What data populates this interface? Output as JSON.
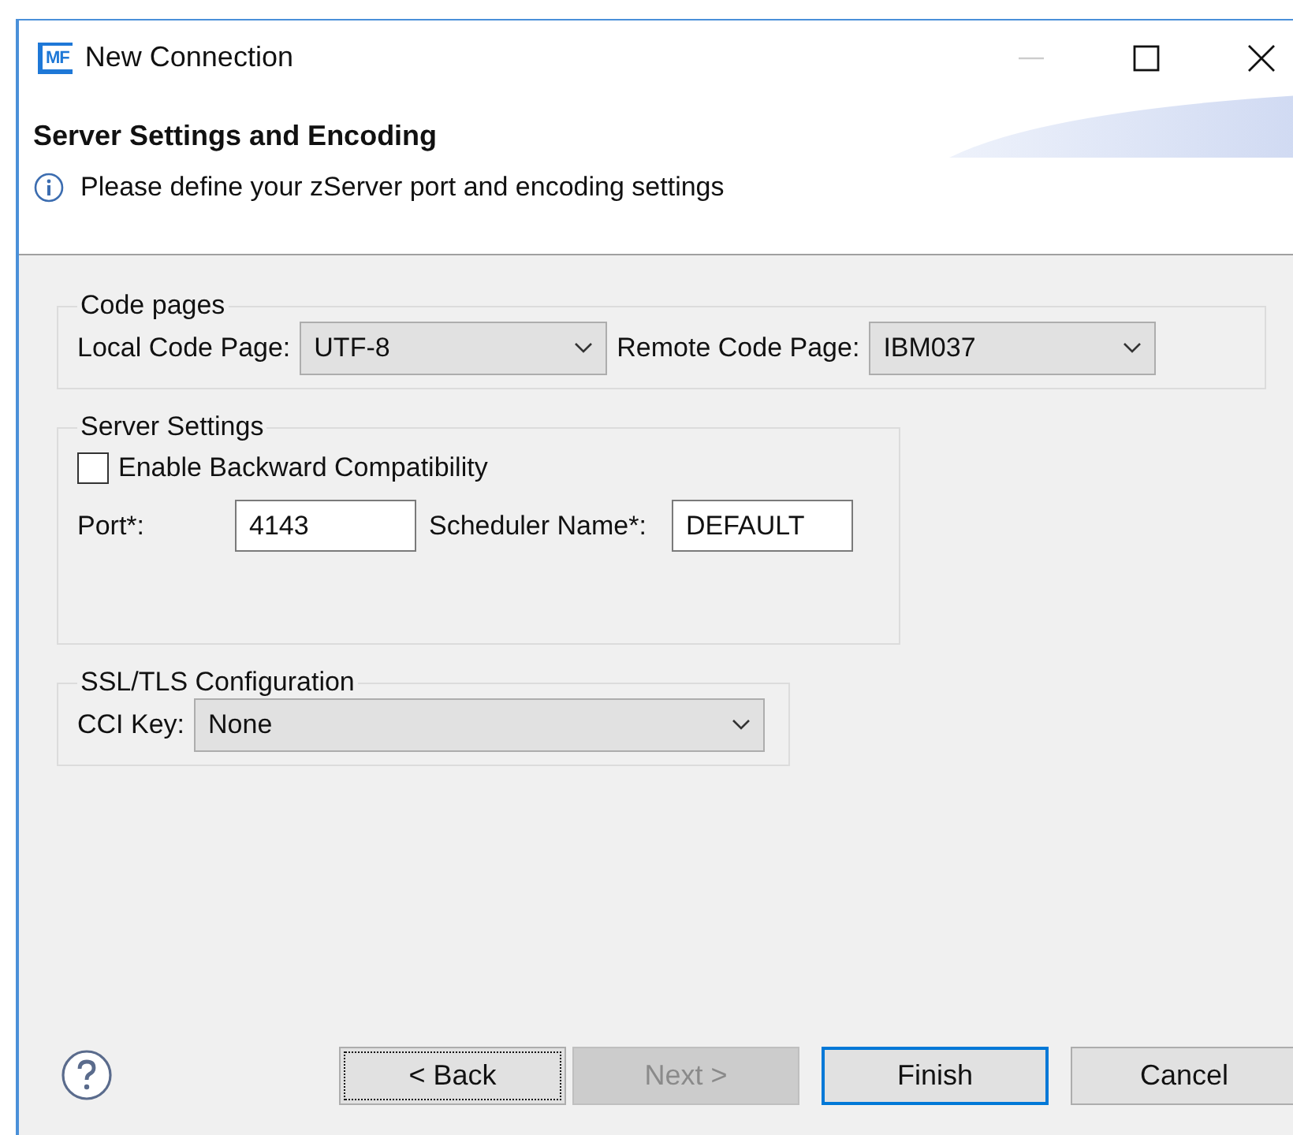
{
  "window": {
    "logo_text": "MF",
    "title": "New Connection",
    "controls": [
      {
        "kind": "minimize",
        "disabled": true
      },
      {
        "kind": "maximize",
        "disabled": false
      },
      {
        "kind": "close",
        "disabled": false
      }
    ]
  },
  "header": {
    "title": "Server Settings and Encoding",
    "message": "Please define your zServer port and encoding settings"
  },
  "groups": [
    {
      "title": "Code pages",
      "kind": "code_pages",
      "local_label": "Local Code Page:",
      "local_value": "UTF-8",
      "remote_label": "Remote Code Page:",
      "remote_value": "IBM037"
    },
    {
      "title": "Server Settings",
      "kind": "server",
      "checkbox_label": "Enable Backward Compatibility",
      "checked": false,
      "port_label": "Port*:",
      "port_value": "4143",
      "scheduler_label": "Scheduler Name*:",
      "scheduler_value": "DEFAULT"
    },
    {
      "title": "SSL/TLS Configuration",
      "kind": "ssl",
      "key_label": "CCI Key:",
      "key_value": "None"
    }
  ],
  "buttons": [
    {
      "label": "< Back",
      "disabled": false,
      "focused": true,
      "default": false
    },
    {
      "label": "Next >",
      "disabled": true,
      "focused": false,
      "default": false
    },
    {
      "label": "Finish",
      "disabled": false,
      "focused": false,
      "default": true
    },
    {
      "label": "Cancel",
      "disabled": false,
      "focused": false,
      "default": false
    }
  ]
}
